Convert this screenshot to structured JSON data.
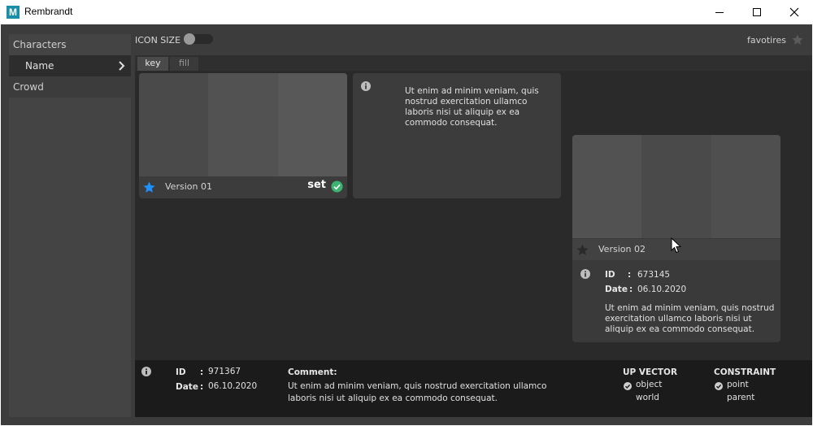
{
  "window": {
    "title": "Rembrandt",
    "app_icon_letter": "M"
  },
  "sidebar": {
    "items": [
      {
        "label": "Characters"
      },
      {
        "label": "Name"
      },
      {
        "label": "Crowd"
      }
    ]
  },
  "toolbar": {
    "icon_size_label": "ICON SIZE",
    "icon_size_toggle": false,
    "favorites_label": "favotires"
  },
  "tabs": [
    {
      "label": "key",
      "active": true
    },
    {
      "label": "fill",
      "active": false
    }
  ],
  "cards": [
    {
      "version": "Version 01",
      "favorite": true,
      "set_label": "set",
      "is_set": true
    },
    {
      "description": "Ut enim ad minim veniam, quis nostrud exercitation ullamco laboris nisi ut aliquip ex ea commodo consequat."
    },
    {
      "version": "Version 02",
      "favorite": false,
      "id_label": "ID",
      "id_value": "673145",
      "date_label": "Date",
      "date_value": "06.10.2020",
      "description": "Ut enim ad minim veniam, quis nostrud exercitation ullamco laboris nisi ut aliquip ex ea commodo consequat."
    }
  ],
  "details": {
    "id_label": "ID",
    "id_value": "971367",
    "date_label": "Date",
    "date_value": "06.10.2020",
    "comment_label": "Comment:",
    "comment": "Ut enim ad minim veniam, quis nostrud exercitation ullamco laboris nisi ut aliquip ex ea commodo consequat.",
    "up_vector": {
      "title": "UP VECTOR",
      "options": [
        "object",
        "world"
      ],
      "selected": "object"
    },
    "constraint": {
      "title": "CONSTRAINT",
      "options": [
        "point",
        "parent"
      ],
      "selected": "point"
    }
  },
  "colors": {
    "accent_blue": "#1e90ff",
    "check_green": "#3cb371",
    "panel_bg": "#3c3c3c",
    "content_bg": "#2a2a2a",
    "detail_bg": "#1b1b1b"
  }
}
